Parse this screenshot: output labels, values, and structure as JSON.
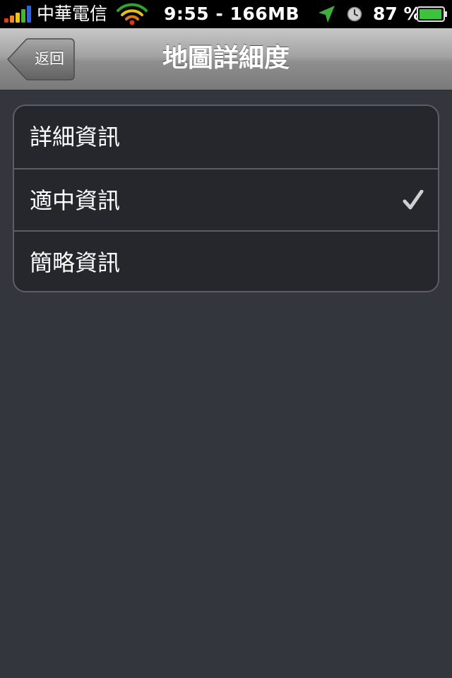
{
  "status_bar": {
    "carrier": "中華電信",
    "time_memory": "9:55 - 166MB",
    "battery": "87 %",
    "icons": [
      "signal-icon",
      "wifi-icon",
      "location-icon",
      "alarm-clock-icon",
      "battery-icon"
    ]
  },
  "nav": {
    "back_label": "返回",
    "title": "地圖詳細度"
  },
  "options": [
    {
      "label": "詳細資訊",
      "selected": false
    },
    {
      "label": "適中資訊",
      "selected": true
    },
    {
      "label": "簡略資訊",
      "selected": false
    }
  ],
  "colors": {
    "background": "#33363c",
    "group_bg": "#25272c",
    "separator": "#5b5e64",
    "checkmark": "#cfcfcf"
  }
}
